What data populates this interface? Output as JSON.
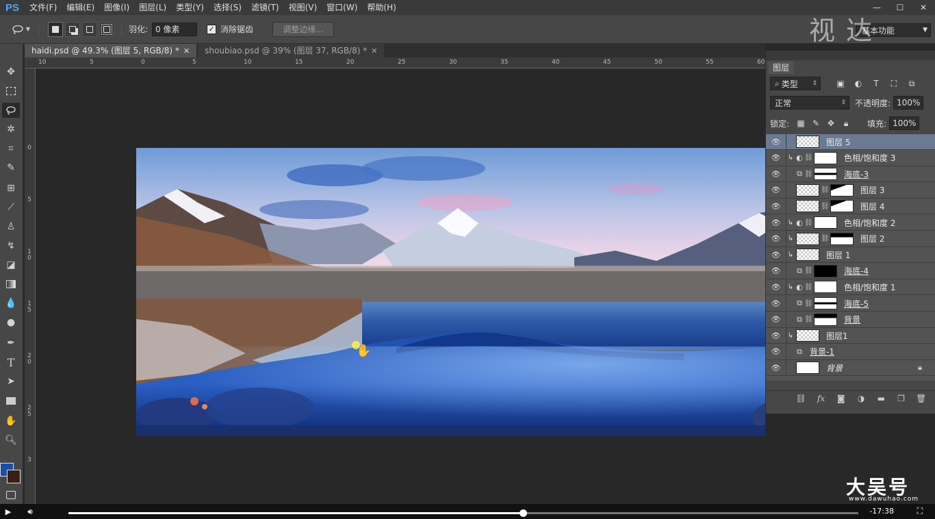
{
  "app": {
    "logo": "PS",
    "menu": [
      "文件(F)",
      "编辑(E)",
      "图像(I)",
      "图层(L)",
      "类型(Y)",
      "选择(S)",
      "滤镜(T)",
      "视图(V)",
      "窗口(W)",
      "帮助(H)"
    ],
    "window_controls": [
      "—",
      "☐",
      "✕"
    ]
  },
  "options": {
    "feather_label": "羽化:",
    "feather_value": "0 像素",
    "antialias_label": "消除锯齿",
    "antialias_checked": true,
    "refine_edge_label": "调整边缘...",
    "workspace": "基本功能"
  },
  "tabs": [
    {
      "label": "haidi.psd @ 49.3% (图层 5, RGB/8) *",
      "active": true,
      "close": "✕"
    },
    {
      "label": "shoubiao.psd @ 39% (图层 37, RGB/8) *",
      "active": false,
      "close": "✕"
    }
  ],
  "ruler_top_labels": [
    "10",
    "5",
    "0",
    "5",
    "10",
    "15",
    "20",
    "25",
    "30",
    "35",
    "40",
    "45",
    "50",
    "55",
    "60"
  ],
  "ruler_left_labels": [
    "0",
    "5",
    "1 0",
    "1 5",
    "2 0",
    "2 5",
    "3"
  ],
  "layers_panel": {
    "tab_label": "图层",
    "filter_type": "类型",
    "blend_mode": "正常",
    "opacity_label": "不透明度:",
    "opacity_value": "100%",
    "lock_label": "锁定:",
    "fill_label": "填充:",
    "fill_value": "100%",
    "layers": [
      {
        "name": "图层 5",
        "selected": true,
        "clip": false,
        "type": "pixel",
        "thumb": "checker",
        "mask": null
      },
      {
        "name": "色相/饱和度 3",
        "selected": false,
        "clip": true,
        "type": "adjustment",
        "thumb": "white",
        "mask": null
      },
      {
        "name": "海底-3",
        "selected": false,
        "clip": false,
        "type": "smart",
        "thumb": "mask-dark",
        "mask": null
      },
      {
        "name": "图层 3",
        "selected": false,
        "clip": false,
        "type": "pixel-mask",
        "thumb": "checker",
        "mask": "mask-shape"
      },
      {
        "name": "图层 4",
        "selected": false,
        "clip": false,
        "type": "pixel-mask",
        "thumb": "checker",
        "mask": "mask-shape"
      },
      {
        "name": "色相/饱和度 2",
        "selected": false,
        "clip": true,
        "type": "adjustment",
        "thumb": "white",
        "mask": null
      },
      {
        "name": "图层 2",
        "selected": false,
        "clip": true,
        "type": "pixel-mask",
        "thumb": "checker",
        "mask": "mask-wave"
      },
      {
        "name": "图层 1",
        "selected": false,
        "clip": true,
        "type": "pixel",
        "thumb": "checker",
        "mask": null
      },
      {
        "name": "海底-4",
        "selected": false,
        "clip": false,
        "type": "smart",
        "thumb": "mask-black",
        "mask": null
      },
      {
        "name": "色相/饱和度 1",
        "selected": false,
        "clip": true,
        "type": "adjustment",
        "thumb": "white",
        "mask": null
      },
      {
        "name": "海底-5",
        "selected": false,
        "clip": false,
        "type": "smart",
        "thumb": "mask-dark",
        "mask": null
      },
      {
        "name": "背景",
        "selected": false,
        "clip": false,
        "type": "smart",
        "thumb": "mask-wave",
        "mask": null
      },
      {
        "name": "图层1",
        "selected": false,
        "clip": true,
        "type": "pixel",
        "thumb": "checker",
        "mask": null
      },
      {
        "name": "背景-1",
        "selected": false,
        "clip": false,
        "type": "smart-plain",
        "thumb": null,
        "mask": null
      },
      {
        "name": "背景",
        "selected": false,
        "clip": false,
        "type": "background",
        "thumb": "white",
        "mask": null
      }
    ],
    "bottom_icons": [
      "link-icon",
      "fx-icon",
      "mask-icon",
      "adjustment-icon",
      "folder-icon",
      "new-layer-icon",
      "trash-icon"
    ],
    "fx_label": "fx"
  },
  "colors": {
    "foreground": "#1a4da8",
    "background": "#3a1f12",
    "selected_layer": "#6a7a93"
  },
  "video": {
    "time": "-17:38",
    "progress": 0.575
  },
  "watermarks": {
    "top": "视 达",
    "bottom": "大吴号",
    "bottom_sub": "www.dawuhao.com"
  }
}
